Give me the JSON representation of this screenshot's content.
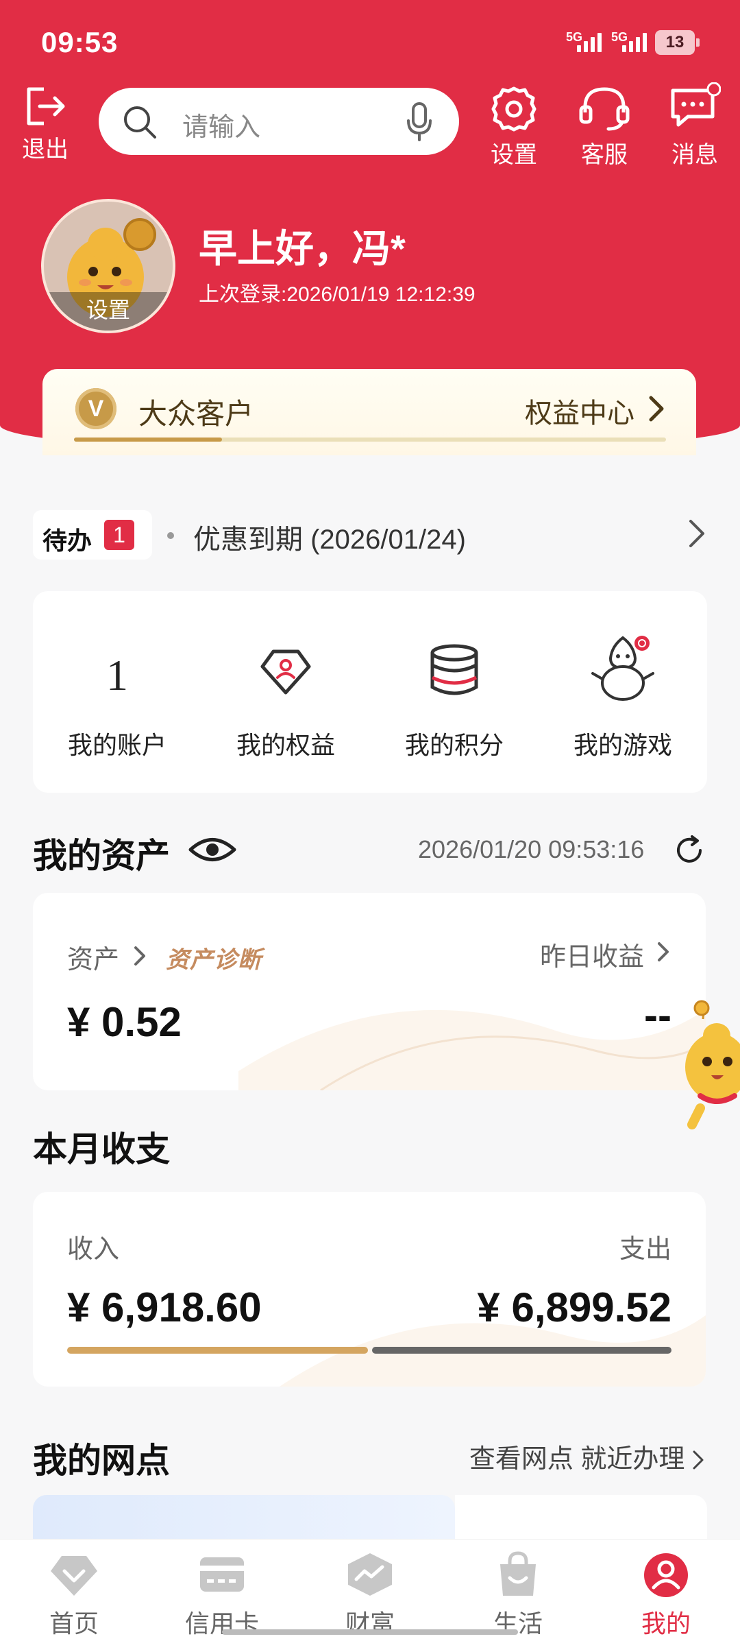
{
  "status_bar": {
    "time": "09:53",
    "sig1": "5G",
    "sig2": "5G",
    "battery": "13"
  },
  "header": {
    "logout_label": "退出",
    "search_placeholder": "请输入",
    "settings_label": "设置",
    "service_label": "客服",
    "messages_label": "消息"
  },
  "profile": {
    "avatar_caption": "设置",
    "greeting": "早上好，冯*",
    "last_login": "上次登录:2026/01/19 12:12:39"
  },
  "tier": {
    "badge": "V",
    "name": "大众客户",
    "link": "权益中心",
    "progress": 0.25
  },
  "todo": {
    "label": "待办",
    "count": "1",
    "text": "优惠到期 (2026/01/24)"
  },
  "quick_items": [
    {
      "value": "1",
      "label": "我的账户"
    },
    {
      "label": "我的权益",
      "icon": "diamond-icon"
    },
    {
      "label": "我的积分",
      "icon": "coin-stack-icon"
    },
    {
      "label": "我的游戏",
      "icon": "snowman-icon"
    }
  ],
  "assets": {
    "title": "我的资产",
    "updated": "2026/01/20 09:53:16",
    "asset_label": "资产",
    "diagnosis": "资产诊断",
    "yesterday_label": "昨日收益",
    "amount": "¥ 0.52",
    "yesterday_value": "--"
  },
  "monthly": {
    "title": "本月收支",
    "income_label": "收入",
    "expense_label": "支出",
    "income": "¥ 6,918.60",
    "expense": "¥ 6,899.52",
    "income_color": "#d4a560",
    "expense_color": "#666666"
  },
  "branch": {
    "title": "我的网点",
    "link": "查看网点 就近办理"
  },
  "tabs": [
    {
      "label": "首页",
      "icon": "home-icon"
    },
    {
      "label": "信用卡",
      "icon": "credit-card-icon"
    },
    {
      "label": "财富",
      "icon": "wealth-icon"
    },
    {
      "label": "生活",
      "icon": "shopping-bag-icon"
    },
    {
      "label": "我的",
      "icon": "profile-icon",
      "active": true
    }
  ],
  "colors": {
    "brand_red": "#e12d45",
    "gold": "#c79a48"
  }
}
